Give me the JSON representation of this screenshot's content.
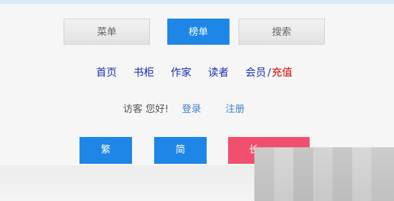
{
  "menu_buttons": {
    "menu": "菜单",
    "ranking": "榜单",
    "search": "搜索"
  },
  "nav": {
    "home": "首页",
    "bookshelf": "书柜",
    "authors": "作家",
    "readers": "读者",
    "member": "会员",
    "slash": "/",
    "recharge": "充值"
  },
  "guest": {
    "greeting": "访客 您好!",
    "login": "登录",
    "register": "注册"
  },
  "actions": {
    "traditional": "繁",
    "simplified": "简",
    "long_partial": "长"
  },
  "colors": {
    "accent_blue": "#1e86e6",
    "nav_text": "#1a2fb3",
    "recharge_red": "#e40000",
    "action_red": "#f0506e"
  }
}
